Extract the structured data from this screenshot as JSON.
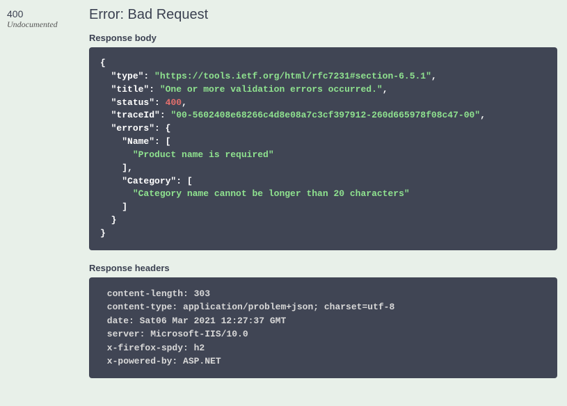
{
  "status_code": "400",
  "undocumented_label": "Undocumented",
  "error_title": "Error: Bad Request",
  "response_body_label": "Response body",
  "response_headers_label": "Response headers",
  "response_body": {
    "type_key": "\"type\"",
    "type_val": "\"https://tools.ietf.org/html/rfc7231#section-6.5.1\"",
    "title_key": "\"title\"",
    "title_val": "\"One or more validation errors occurred.\"",
    "status_key": "\"status\"",
    "status_val": "400",
    "traceId_key": "\"traceId\"",
    "traceId_val": "\"00-5602408e68266c4d8e08a7c3cf397912-260d665978f08c47-00\"",
    "errors_key": "\"errors\"",
    "name_key": "\"Name\"",
    "name_err": "\"Product name is required\"",
    "category_key": "\"Category\"",
    "category_err": "\"Category name cannot be longer than 20 characters\""
  },
  "headers": {
    "content_length": " content-length: 303 ",
    "content_type": " content-type: application/problem+json; charset=utf-8 ",
    "date": " date: Sat06 Mar 2021 12:27:37 GMT ",
    "server": " server: Microsoft-IIS/10.0 ",
    "x_firefox_spdy": " x-firefox-spdy: h2 ",
    "x_powered_by": " x-powered-by: ASP.NET "
  }
}
